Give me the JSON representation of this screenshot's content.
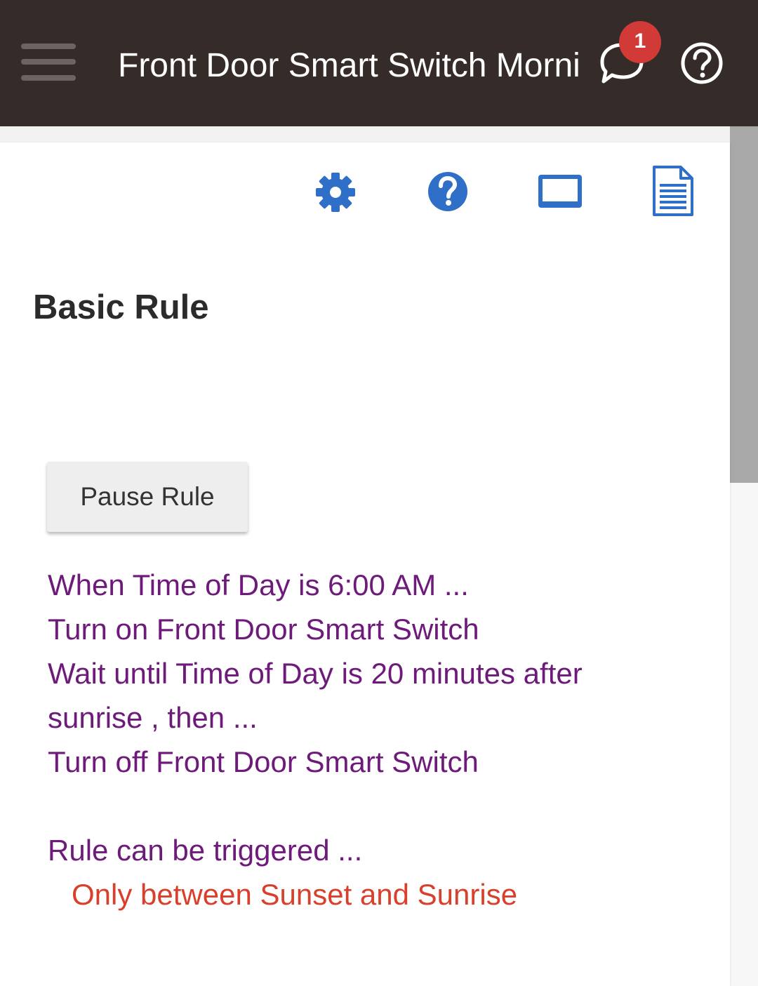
{
  "header": {
    "title": "Front Door Smart Switch Morning",
    "notification_count": "1",
    "icons": [
      "menu-icon",
      "chat-bubble-icon",
      "help-circle-icon"
    ]
  },
  "toolbar": {
    "icons": [
      "gear-icon",
      "question-icon",
      "tablet-icon",
      "document-icon"
    ]
  },
  "page": {
    "title": "Basic Rule"
  },
  "actions": {
    "pause_label": "Pause Rule"
  },
  "rule": {
    "lines": [
      "When Time of Day is 6:00 AM ...",
      "Turn on Front Door Smart Switch",
      "Wait until Time of Day is 20 minutes after",
      "sunrise , then ...",
      "Turn off Front Door Smart Switch"
    ],
    "trigger_heading": "Rule can be triggered ...",
    "trigger_condition": "Only between Sunset and Sunrise"
  },
  "colors": {
    "header_bg": "#352c29",
    "badge": "#d13a36",
    "icon_blue": "#2f6fc7",
    "rule_text": "#6e1a7a",
    "condition_text": "#d8402b"
  }
}
